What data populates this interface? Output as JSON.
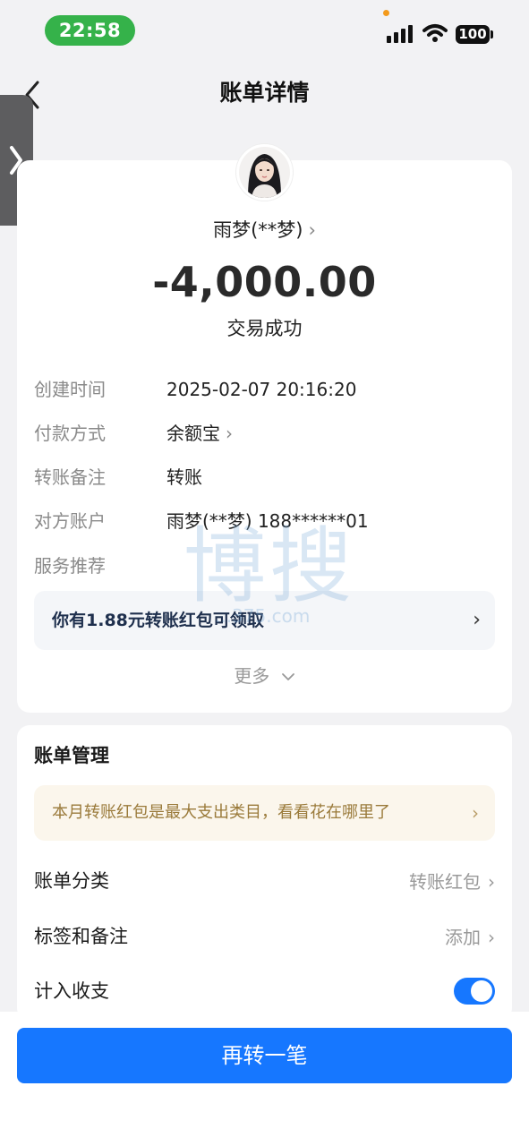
{
  "status_bar": {
    "time": "22:58",
    "battery": "100"
  },
  "nav": {
    "title": "账单详情"
  },
  "payee": {
    "name": "雨梦(**梦)",
    "chevron": "›"
  },
  "transaction": {
    "amount": "-4,000.00",
    "status": "交易成功"
  },
  "details": [
    {
      "label": "创建时间",
      "value": "2025-02-07 20:16:20"
    },
    {
      "label": "付款方式",
      "value": "余额宝"
    },
    {
      "label": "转账备注",
      "value": "转账"
    },
    {
      "label": "对方账户",
      "value": "雨梦(**梦) 188******01"
    },
    {
      "label": "服务推荐",
      "value": ""
    }
  ],
  "promo": {
    "text": "你有1.88元转账红包可领取"
  },
  "more": {
    "label": "更多"
  },
  "watermark": {
    "text": "博搜",
    "sub": "...375.com"
  },
  "bill_management": {
    "title": "账单管理",
    "tip": "本月转账红包是最大支出类目，看看花在哪里了",
    "rows": [
      {
        "label": "账单分类",
        "value": "转账红包"
      },
      {
        "label": "标签和备注",
        "value": "添加"
      },
      {
        "label": "计入收支",
        "value": ""
      }
    ],
    "count_in_budget": true
  },
  "cta": {
    "label": "再转一笔"
  },
  "colors": {
    "accent": "#1677ff",
    "time_pill": "#35b24a",
    "tip_text": "#9a7a3a"
  }
}
